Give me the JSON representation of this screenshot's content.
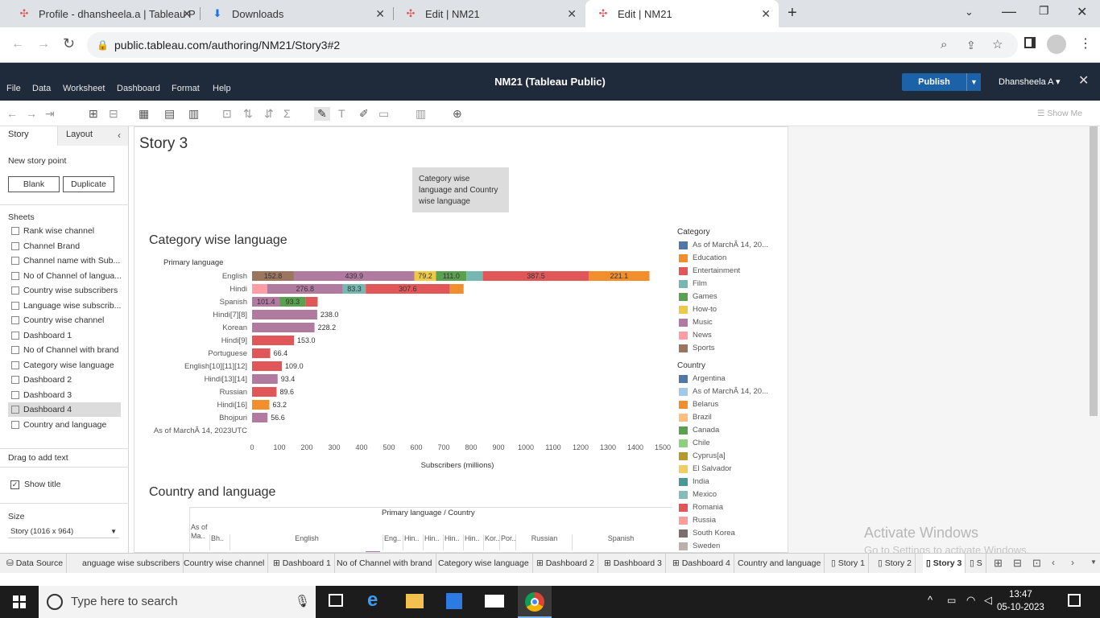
{
  "browser": {
    "tabs": [
      {
        "title": "Profile - dhansheela.a | Tableau P",
        "icon": "tableau-icon"
      },
      {
        "title": "Downloads",
        "icon": "download-icon"
      },
      {
        "title": "Edit | NM21",
        "icon": "tableau-icon"
      },
      {
        "title": "Edit | NM21",
        "icon": "tableau-icon"
      }
    ],
    "url": "public.tableau.com/authoring/NM21/Story3#2"
  },
  "tableau": {
    "menus": [
      "File",
      "Data",
      "Worksheet",
      "Dashboard",
      "Format",
      "Help"
    ],
    "workbook_title": "NM21 (Tableau Public)",
    "publish_label": "Publish",
    "user": "Dhansheela A ▾",
    "show_me": "Show Me"
  },
  "left_pane": {
    "tabs": [
      "Story",
      "Layout"
    ],
    "new_story_point": "New story point",
    "blank": "Blank",
    "duplicate": "Duplicate",
    "sheets_title": "Sheets",
    "sheets": [
      "Rank wise channel",
      "Channel Brand",
      "Channel name with Sub...",
      "No of Channel of langua...",
      "Country wise subscribers",
      "Language wise subscrib...",
      "Country wise channel",
      "Dashboard 1",
      "No of Channel with brand",
      "Category wise language",
      "Dashboard 2",
      "Dashboard 3",
      "Dashboard 4",
      "Country and language"
    ],
    "drag_text": "Drag to add text",
    "show_title": "Show title",
    "size_title": "Size",
    "size_value": "Story (1016 x 964)"
  },
  "story": {
    "title": "Story 3",
    "caption": "Category wise language and Country wise language",
    "chart1_title": "Category wise language",
    "chart2_title": "Country and language",
    "chart2_header": "Primary language / Country",
    "chart2_cols": [
      "As of Ma..",
      "Bh..",
      "English",
      "Eng..",
      "Hin..",
      "Hin..",
      "Hin..",
      "Hin..",
      "Kor..",
      "Por..",
      "Russian",
      "Spanish"
    ]
  },
  "chart_data": {
    "type": "bar",
    "orientation": "horizontal-stacked",
    "xlabel": "Subscribers (millions)",
    "ylabel": "Primary language",
    "xlim": [
      0,
      1500
    ],
    "xticks": [
      0,
      100,
      200,
      300,
      400,
      500,
      600,
      700,
      800,
      900,
      1000,
      1100,
      1200,
      1300,
      1400,
      1500
    ],
    "categories": [
      "English",
      "Hindi",
      "Spanish",
      "Hindi[7][8]",
      "Korean",
      "Hindi[9]",
      "Portuguese",
      "English[10][11][12]",
      "Hindi[13][14]",
      "Russian",
      "Hindi[16]",
      "Bhojpuri",
      "As of MarchÂ 14, 2023UTC"
    ],
    "segments": [
      [
        {
          "cat": "Sports",
          "value": 152.8,
          "label": "152.8"
        },
        {
          "cat": "Music",
          "value": 439.9,
          "label": "439.9"
        },
        {
          "cat": "How-to",
          "value": 79.2,
          "label": "79.2"
        },
        {
          "cat": "Games",
          "value": 111.0,
          "label": "111.0"
        },
        {
          "cat": "Film",
          "value": 60,
          "label": ""
        },
        {
          "cat": "Entertainment",
          "value": 387.5,
          "label": "387.5"
        },
        {
          "cat": "Education",
          "value": 221.1,
          "label": "221.1"
        }
      ],
      [
        {
          "cat": "News",
          "value": 55,
          "label": ""
        },
        {
          "cat": "Music",
          "value": 276.8,
          "label": "276.8"
        },
        {
          "cat": "Film",
          "value": 83.3,
          "label": "83.3"
        },
        {
          "cat": "Entertainment",
          "value": 307.6,
          "label": "307.6"
        },
        {
          "cat": "Education",
          "value": 50,
          "label": ""
        }
      ],
      [
        {
          "cat": "Music",
          "value": 101.4,
          "label": "101.4"
        },
        {
          "cat": "Games",
          "value": 93.3,
          "label": "93.3"
        },
        {
          "cat": "Entertainment",
          "value": 45,
          "label": ""
        }
      ],
      [
        {
          "cat": "Music",
          "value": 238.0,
          "label": "238.0"
        }
      ],
      [
        {
          "cat": "Music",
          "value": 228.2,
          "label": "228.2"
        }
      ],
      [
        {
          "cat": "Entertainment",
          "value": 153.0,
          "label": "153.0"
        }
      ],
      [
        {
          "cat": "Entertainment",
          "value": 66.4,
          "label": "66.4"
        }
      ],
      [
        {
          "cat": "Entertainment",
          "value": 109.0,
          "label": "109.0"
        }
      ],
      [
        {
          "cat": "Music",
          "value": 93.4,
          "label": "93.4"
        }
      ],
      [
        {
          "cat": "Entertainment",
          "value": 89.6,
          "label": "89.6"
        }
      ],
      [
        {
          "cat": "Education",
          "value": 63.2,
          "label": "63.2"
        }
      ],
      [
        {
          "cat": "Music",
          "value": 56.6,
          "label": "56.6"
        }
      ],
      []
    ],
    "colors": {
      "As of MarchÂ 14, 20...": "#4e79a7",
      "Education": "#f28e2b",
      "Entertainment": "#e15759",
      "Film": "#76b7b2",
      "Games": "#59a14f",
      "How-to": "#edc948",
      "Music": "#b07aa1",
      "News": "#ff9da7",
      "Sports": "#9c755f"
    }
  },
  "legend_category": {
    "title": "Category",
    "items": [
      {
        "label": "As of MarchÂ 14, 20...",
        "color": "#4e79a7"
      },
      {
        "label": "Education",
        "color": "#f28e2b"
      },
      {
        "label": "Entertainment",
        "color": "#e15759"
      },
      {
        "label": "Film",
        "color": "#76b7b2"
      },
      {
        "label": "Games",
        "color": "#59a14f"
      },
      {
        "label": "How-to",
        "color": "#edc948"
      },
      {
        "label": "Music",
        "color": "#b07aa1"
      },
      {
        "label": "News",
        "color": "#ff9da7"
      },
      {
        "label": "Sports",
        "color": "#9c755f"
      }
    ]
  },
  "legend_country": {
    "title": "Country",
    "items": [
      {
        "label": "Argentina",
        "color": "#4e79a7"
      },
      {
        "label": "As of MarchÂ 14, 20...",
        "color": "#a0cbe8"
      },
      {
        "label": "Belarus",
        "color": "#f28e2b"
      },
      {
        "label": "Brazil",
        "color": "#ffbe7d"
      },
      {
        "label": "Canada",
        "color": "#59a14f"
      },
      {
        "label": "Chile",
        "color": "#8cd17d"
      },
      {
        "label": "Cyprus[a]",
        "color": "#b6992d"
      },
      {
        "label": "El Salvador",
        "color": "#f1ce63"
      },
      {
        "label": "India",
        "color": "#499894"
      },
      {
        "label": "Mexico",
        "color": "#86bcb6"
      },
      {
        "label": "Romania",
        "color": "#e15759"
      },
      {
        "label": "Russia",
        "color": "#ff9d9a"
      },
      {
        "label": "South Korea",
        "color": "#79706e"
      },
      {
        "label": "Sweden",
        "color": "#bab0ac"
      }
    ]
  },
  "bottom_tabs": [
    "Data Source",
    "anguage wise subscribers",
    "Country wise channel",
    "Dashboard 1",
    "No of Channel with brand",
    "Category wise language",
    "Dashboard 2",
    "Dashboard 3",
    "Dashboard 4",
    "Country and language",
    "Story 1",
    "Story 2",
    "Story 3",
    "S"
  ],
  "windows": {
    "search_placeholder": "Type here to search",
    "watermark1": "Activate Windows",
    "watermark2": "Go to Settings to activate Windows.",
    "time": "13:47",
    "date": "05-10-2023"
  }
}
